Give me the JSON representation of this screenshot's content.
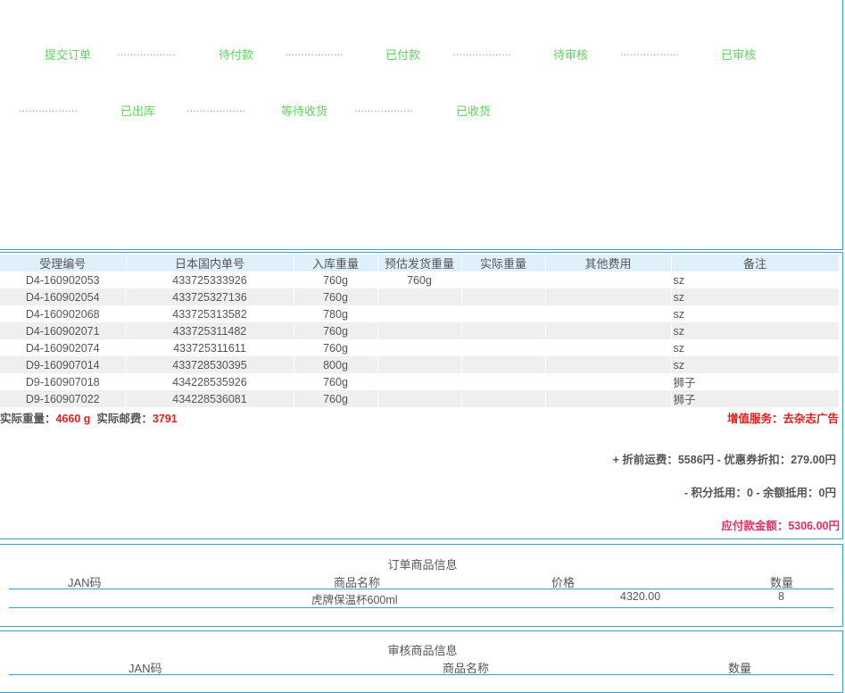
{
  "progress": {
    "row1": [
      "提交订单",
      "待付款",
      "已付款",
      "待审核",
      "已审核"
    ],
    "row2": [
      "已出库",
      "等待收货",
      "已收货"
    ],
    "separator": "………………"
  },
  "shipping_table": {
    "headers": [
      "受理编号",
      "日本国内单号",
      "入库重量",
      "预估发货重量",
      "实际重量",
      "其他费用",
      "备注"
    ],
    "rows": [
      [
        "D4-160902053",
        "433725333926",
        "760g",
        "760g",
        "",
        "",
        "sz"
      ],
      [
        "D4-160902054",
        "433725327136",
        "760g",
        "",
        "",
        "",
        "sz"
      ],
      [
        "D4-160902068",
        "433725313582",
        "780g",
        "",
        "",
        "",
        "sz"
      ],
      [
        "D4-160902071",
        "433725311482",
        "760g",
        "",
        "",
        "",
        "sz"
      ],
      [
        "D4-160902074",
        "433725311611",
        "760g",
        "",
        "",
        "",
        "sz"
      ],
      [
        "D9-160907014",
        "433728530395",
        "800g",
        "",
        "",
        "",
        "sz"
      ],
      [
        "D9-160907018",
        "434228535926",
        "760g",
        "",
        "",
        "",
        "狮子"
      ],
      [
        "D9-160907022",
        "434228536081",
        "760g",
        "",
        "",
        "",
        "狮子"
      ]
    ]
  },
  "summary": {
    "weight_label": "实际重量：",
    "weight_value": "4660 g",
    "postage_label": "实际邮费：",
    "postage_value": "3791",
    "value_added": "增值服务：去杂志广告",
    "fee_line": "+ 折前运费：5586円 - 优惠券折扣：279.00円",
    "points_line": "- 积分抵用：0 - 余额抵用：0円",
    "payable": "应付款金额：5306.00円"
  },
  "order_goods": {
    "title": "订单商品信息",
    "headers": [
      "JAN码",
      "商品名称",
      "价格",
      "数量"
    ],
    "rows": [
      [
        "",
        "虎牌保温杯600ml",
        "4320.00",
        "8"
      ]
    ]
  },
  "review_goods": {
    "title": "审核商品信息",
    "headers": [
      "JAN码",
      "商品名称",
      "数量"
    ]
  }
}
